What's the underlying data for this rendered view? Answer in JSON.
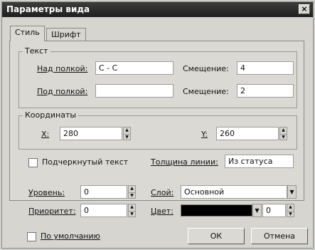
{
  "window": {
    "title": "Параметры вида",
    "close_label": "×"
  },
  "tabs": {
    "style": "Стиль",
    "font": "Шрифт"
  },
  "text_group": {
    "legend": "Текст",
    "above_label": "Над полкой:",
    "above_value": "С - С",
    "below_label": "Под полкой:",
    "below_value": "",
    "offset_label": "Смещение:",
    "offset1_value": "4",
    "offset2_value": "2"
  },
  "coords_group": {
    "legend": "Координаты",
    "x_label": "X:",
    "x_value": "280",
    "y_label": "Y:",
    "y_value": "260"
  },
  "underlined_text": {
    "label": "Подчеркнутый текст",
    "checked": false
  },
  "line_width": {
    "label": "Толщина линии:",
    "value": "Из статуса"
  },
  "level": {
    "label": "Уровень:",
    "value": "0"
  },
  "layer": {
    "label": "Слой:",
    "value": "Основной"
  },
  "priority": {
    "label": "Приоритет:",
    "value": "0"
  },
  "color": {
    "label": "Цвет:",
    "swatch": "#000000",
    "value": "0"
  },
  "default_check": {
    "label": "По умолчанию",
    "checked": false
  },
  "buttons": {
    "ok": "ОК",
    "cancel": "Отмена"
  },
  "icons": {
    "spin_up": "▲",
    "spin_down": "▼",
    "dropdown": "▼"
  }
}
